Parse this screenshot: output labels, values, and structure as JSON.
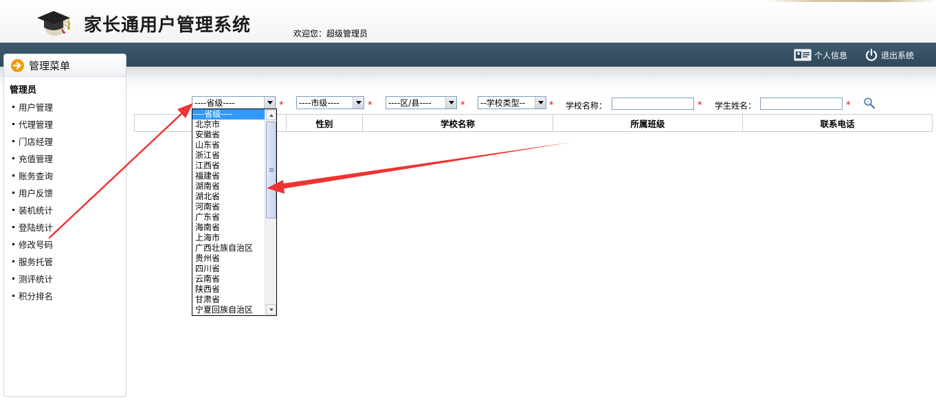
{
  "header": {
    "app_title": "家长通用户管理系统",
    "welcome_label": "欢迎您：",
    "welcome_user": "超级管理员",
    "logo_icon": "graduation-cap-icon"
  },
  "topbar": {
    "profile_label": "个人信息",
    "logout_label": "退出系统"
  },
  "sidebar": {
    "title": "管理菜单",
    "group_label": "管理员",
    "items": [
      {
        "label": "用户管理"
      },
      {
        "label": "代理管理"
      },
      {
        "label": "门店经理"
      },
      {
        "label": "充值管理"
      },
      {
        "label": "账务查询"
      },
      {
        "label": "用户反馈"
      },
      {
        "label": "装机统计"
      },
      {
        "label": "登陆统计"
      },
      {
        "label": "修改号码"
      },
      {
        "label": "服务托管"
      },
      {
        "label": "测评统计"
      },
      {
        "label": "积分排名"
      }
    ]
  },
  "filters": {
    "province_value": "----省级----",
    "city_value": "----市级----",
    "district_value": "----区/县----",
    "school_type_value": "--学校类型--",
    "required_mark": "*",
    "school_name_label": "学校名称：",
    "school_name_value": "",
    "student_name_label": "学生姓名：",
    "student_name_value": ""
  },
  "table": {
    "columns": [
      "",
      "性别",
      "学校名称",
      "所属班级",
      "联系电话"
    ]
  },
  "province_dropdown": {
    "options": [
      "----省级----",
      "北京市",
      "安徽省",
      "山东省",
      "浙江省",
      "江西省",
      "福建省",
      "湖南省",
      "湖北省",
      "河南省",
      "广东省",
      "海南省",
      "上海市",
      "广西壮族自治区",
      "贵州省",
      "四川省",
      "云南省",
      "陕西省",
      "甘肃省",
      "宁夏回族自治区"
    ],
    "selected_index": 0
  },
  "colors": {
    "topbar": "#3a5568",
    "accent_orange": "#f29b0d",
    "selection_blue": "#3399ff",
    "required_red": "#ee0000",
    "annotation_red": "#ee3333"
  }
}
